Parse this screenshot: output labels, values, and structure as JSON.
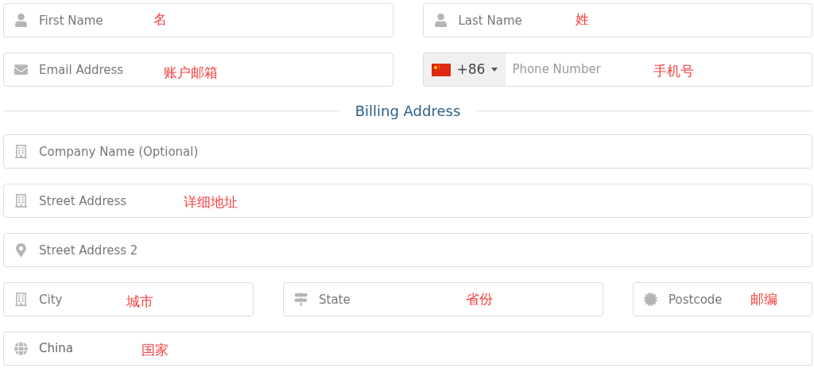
{
  "rows": [
    {
      "kind": "fields",
      "fields": [
        {
          "placeholder": "First Name",
          "annotation": "名"
        },
        {
          "placeholder": "Last Name",
          "annotation": "姓"
        }
      ]
    },
    {
      "kind": "fields",
      "fields": [
        {
          "placeholder": "Email Address",
          "annotation": "账户邮箱"
        },
        {
          "prefix": "+86",
          "placeholder": "Phone Number",
          "annotation": "手机号"
        }
      ]
    },
    {
      "kind": "divider",
      "title": "Billing Address"
    },
    {
      "kind": "fields",
      "fields": [
        {
          "placeholder": "Company Name (Optional)"
        }
      ]
    },
    {
      "kind": "fields",
      "fields": [
        {
          "placeholder": "Street Address",
          "annotation": "详细地址"
        }
      ]
    },
    {
      "kind": "fields",
      "fields": [
        {
          "placeholder": "Street Address 2"
        }
      ]
    },
    {
      "kind": "fields",
      "fields": [
        {
          "placeholder": "City",
          "annotation": "城市"
        },
        {
          "placeholder": "State",
          "annotation": "省份"
        },
        {
          "placeholder": "Postcode",
          "annotation": "邮编"
        }
      ]
    },
    {
      "kind": "fields",
      "fields": [
        {
          "value": "China",
          "annotation": "国家"
        }
      ]
    }
  ]
}
